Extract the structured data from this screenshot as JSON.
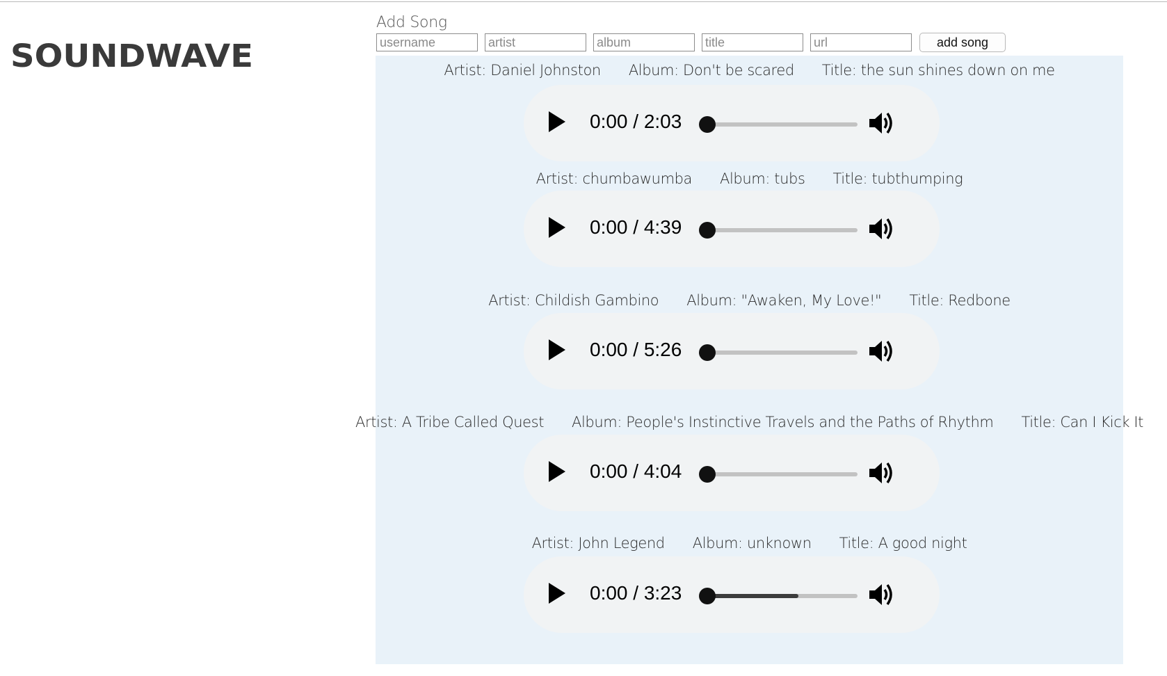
{
  "app": {
    "logo_text": "SOUNDWAVE"
  },
  "add_song": {
    "heading": "Add Song",
    "username_placeholder": "username",
    "artist_placeholder": "artist",
    "album_placeholder": "album",
    "title_placeholder": "title",
    "url_placeholder": "url",
    "submit_label": "add song"
  },
  "songs": [
    {
      "artist": "Artist: Daniel Johnston",
      "album": "Album: Don't be scared",
      "title": "Title: the sun shines down on me",
      "time": "0:00 / 2:03",
      "buffered": 0
    },
    {
      "artist": "Artist: chumbawumba",
      "album": "Album: tubs",
      "title": "Title: tubthumping",
      "time": "0:00 / 4:39",
      "buffered": 0
    },
    {
      "artist": "Artist: Childish Gambino",
      "album": "Album: \"Awaken, My Love!\"",
      "title": "Title: Redbone",
      "time": "0:00 / 5:26",
      "buffered": 0
    },
    {
      "artist": "Artist: A Tribe Called Quest",
      "album": "Album: People's Instinctive Travels and the Paths of Rhythm",
      "title": "Title: Can I Kick It",
      "time": "0:00 / 4:04",
      "buffered": 0
    },
    {
      "artist": "Artist: John Legend",
      "album": "Album: unknown",
      "title": "Title: A good night",
      "time": "0:00 / 3:23",
      "buffered": 0.62
    }
  ],
  "icons": {
    "play": "play-icon",
    "volume": "volume-icon"
  }
}
